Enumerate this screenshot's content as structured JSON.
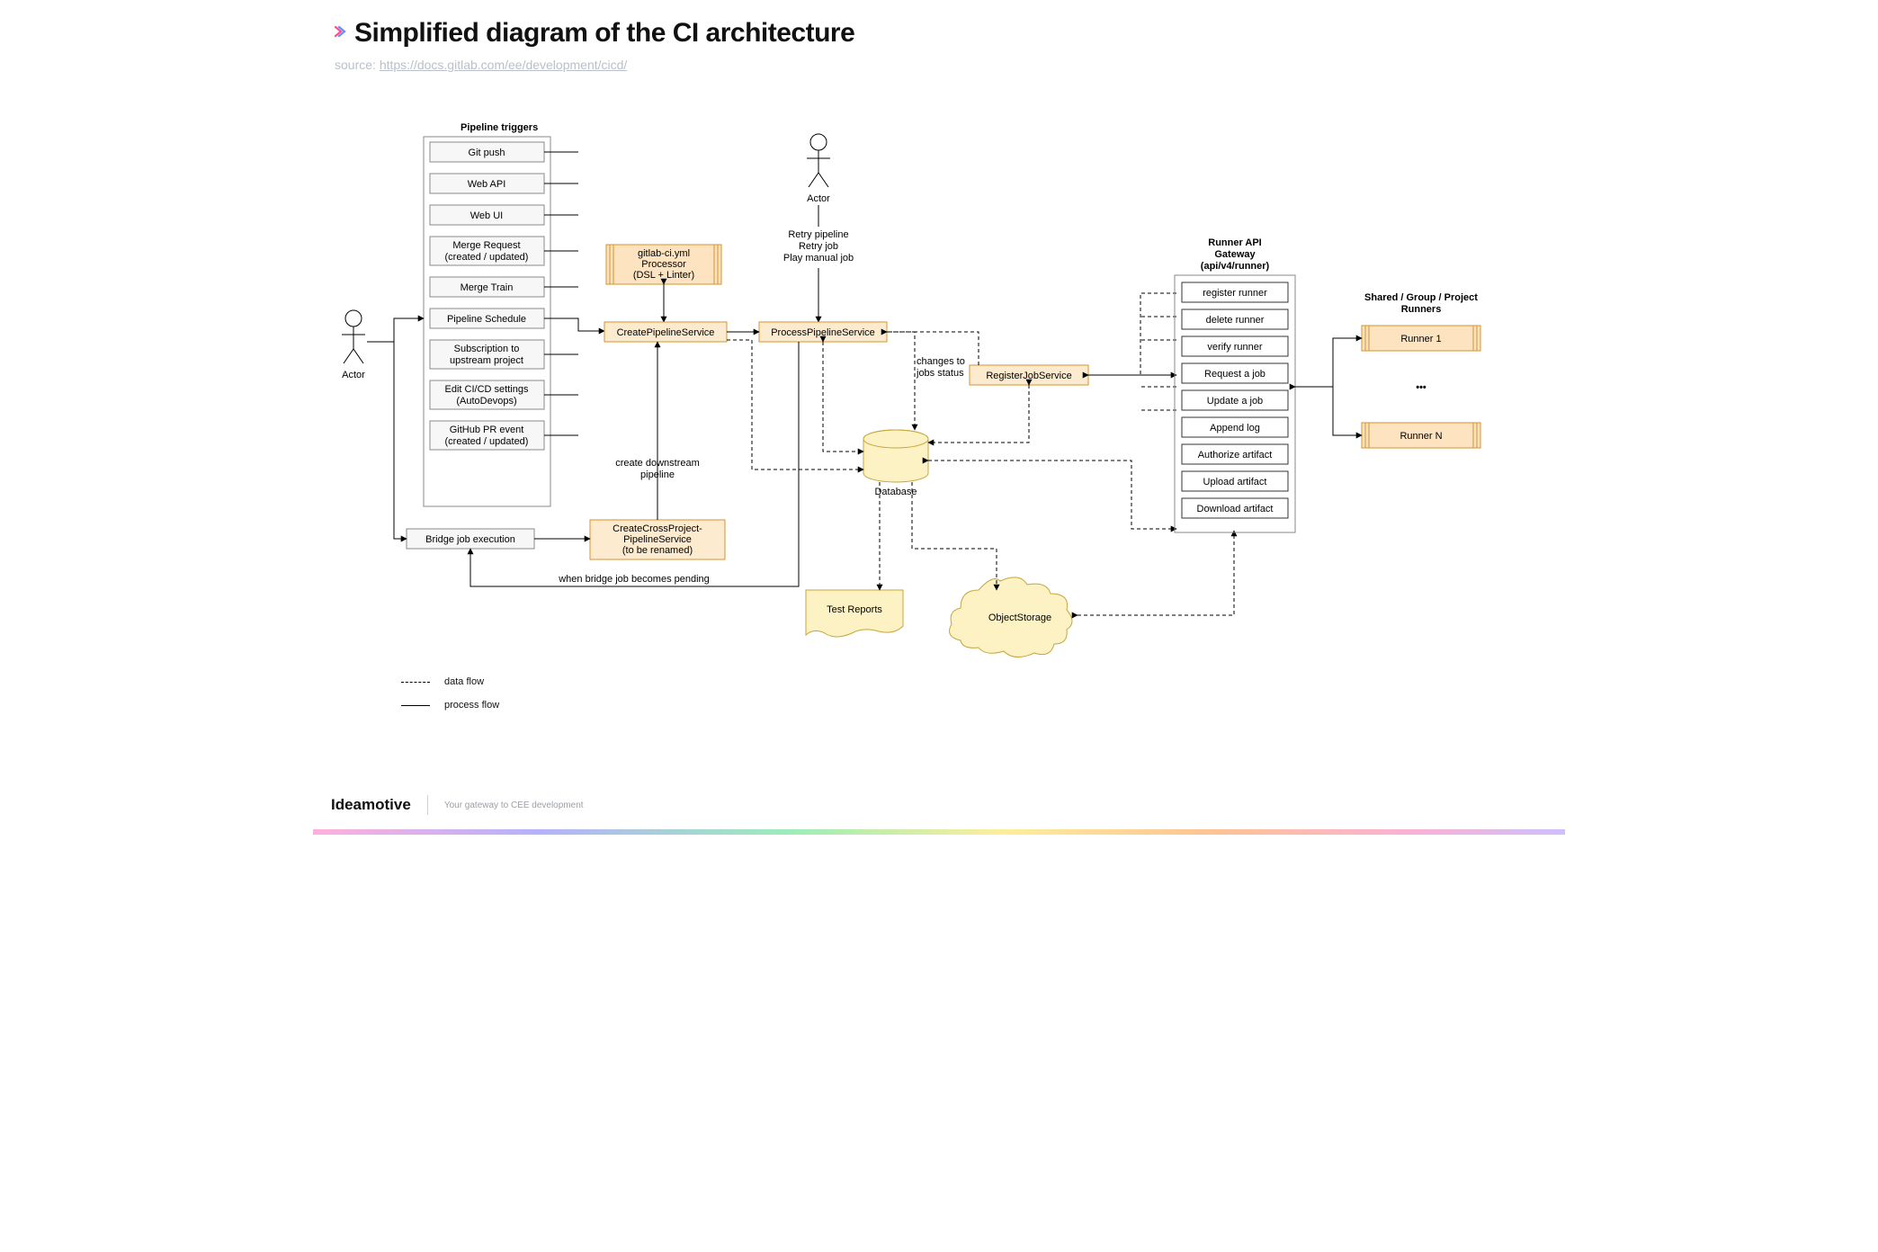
{
  "page_title": "Simplified diagram of the CI architecture",
  "source_label": "source: ",
  "source_link": "https://docs.gitlab.com/ee/development/cicd/",
  "actors": {
    "left": "Actor",
    "top": "Actor"
  },
  "triggers": {
    "title": "Pipeline triggers",
    "items": [
      "Git push",
      "Web API",
      "Web UI",
      "Merge Request\n(created / updated)",
      "Merge Train",
      "Pipeline Schedule",
      "Subscription to\nupstream project",
      "Edit CI/CD settings\n(AutoDevops)",
      "GitHub PR event\n(created / updated)"
    ]
  },
  "bridge_job": "Bridge job execution",
  "services": {
    "yml_processor": "gitlab-ci.yml\nProcessor\n(DSL + Linter)",
    "create_pipeline": "CreatePipelineService",
    "process_pipeline": "ProcessPipelineService",
    "cross_project": "CreateCrossProject-\nPipelineService\n(to be renamed)",
    "register_job": "RegisterJobService"
  },
  "actor_actions": "Retry pipeline\nRetry job\nPlay manual job",
  "labels": {
    "changes_jobs": "changes to\njobs status",
    "create_downstream": "create downstream\npipeline",
    "when_bridge": "when bridge job becomes pending"
  },
  "storage": {
    "database": "Database",
    "test_reports": "Test Reports",
    "object_storage": "ObjectStorage"
  },
  "gateway": {
    "title": "Runner API\nGateway\n(api/v4/runner)",
    "items": [
      "register runner",
      "delete runner",
      "verify runner",
      "Request a job",
      "Update a job",
      "Append log",
      "Authorize artifact",
      "Upload artifact",
      "Download artifact"
    ]
  },
  "runners": {
    "title": "Shared / Group / Project\nRunners",
    "items": [
      "Runner 1",
      "Runner N"
    ],
    "ellipsis": "•••"
  },
  "legend": {
    "data_flow": "data flow",
    "process_flow": "process flow"
  },
  "footer": {
    "brand": "Ideamotive",
    "tagline": "Your gateway to CEE development"
  }
}
